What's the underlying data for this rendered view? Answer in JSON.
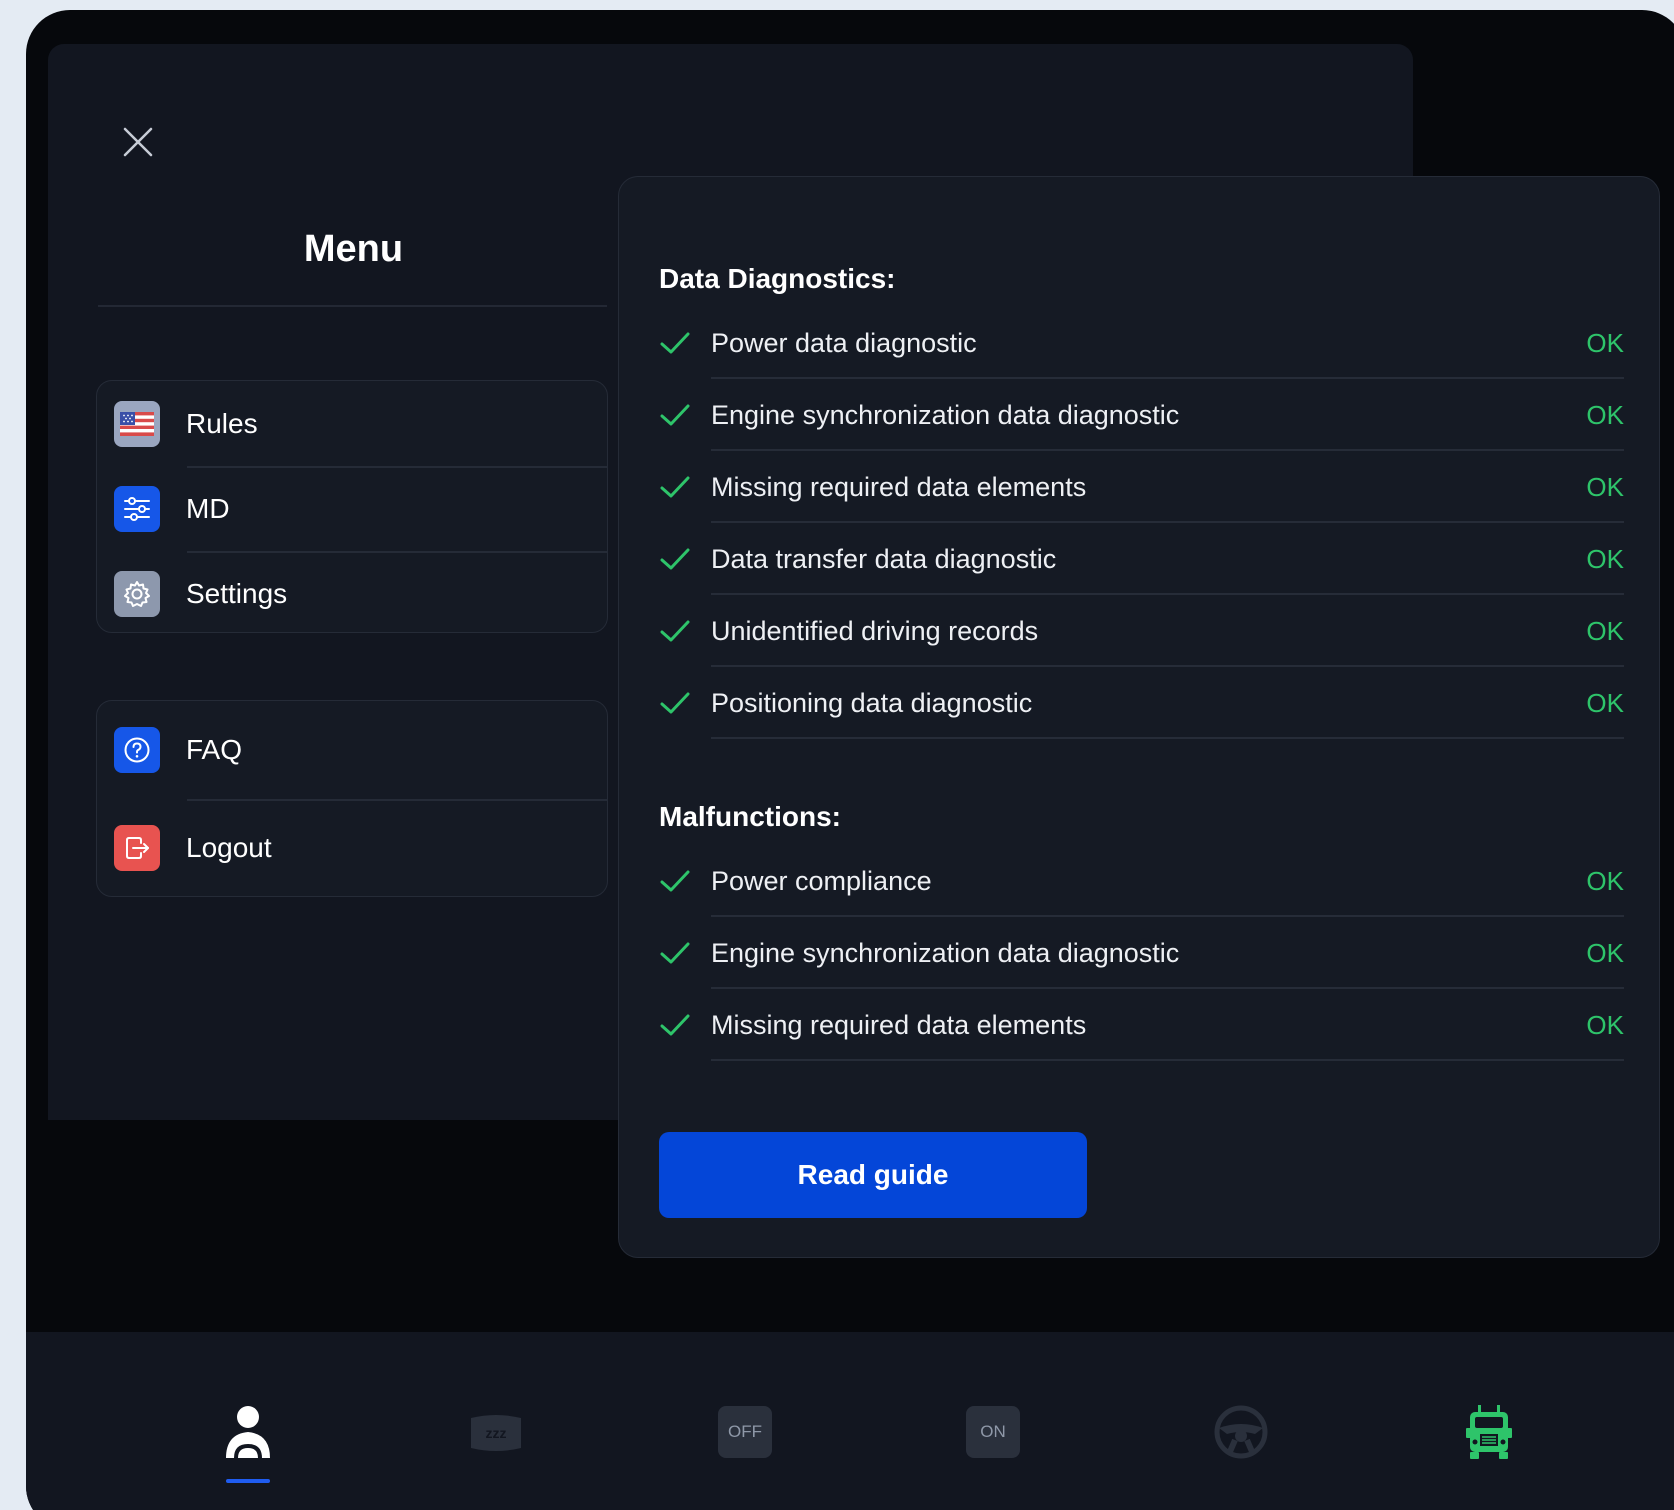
{
  "menu": {
    "title": "Menu",
    "top_items": [
      {
        "label": "Rules",
        "icon": "us-flag-icon"
      },
      {
        "label": "MD",
        "icon": "sliders-icon"
      },
      {
        "label": "Settings",
        "icon": "gear-icon"
      }
    ],
    "bottom_items": [
      {
        "label": "FAQ",
        "icon": "question-icon"
      },
      {
        "label": "Logout",
        "icon": "logout-icon"
      }
    ]
  },
  "diagnostics": {
    "data_title": "Data Diagnostics:",
    "data_items": [
      {
        "label": "Power data diagnostic",
        "status": "OK"
      },
      {
        "label": "Engine synchronization data diagnostic",
        "status": "OK"
      },
      {
        "label": "Missing required data elements",
        "status": "OK"
      },
      {
        "label": "Data transfer data diagnostic",
        "status": "OK"
      },
      {
        "label": "Unidentified driving records",
        "status": "OK"
      },
      {
        "label": "Positioning data diagnostic",
        "status": "OK"
      }
    ],
    "malfunctions_title": "Malfunctions:",
    "malfunction_items": [
      {
        "label": "Power compliance",
        "status": "OK"
      },
      {
        "label": "Engine synchronization data diagnostic",
        "status": "OK"
      },
      {
        "label": "Missing required data elements",
        "status": "OK"
      }
    ],
    "read_guide_label": "Read guide"
  },
  "bottom_nav": {
    "items": [
      {
        "icon": "driver-icon",
        "label": "",
        "active": true
      },
      {
        "icon": "sleeper-icon",
        "label": ""
      },
      {
        "icon": "off-duty-icon",
        "label": "OFF"
      },
      {
        "icon": "on-duty-icon",
        "label": "ON"
      },
      {
        "icon": "steering-wheel-icon",
        "label": ""
      },
      {
        "icon": "truck-icon",
        "label": ""
      }
    ]
  },
  "colors": {
    "accent": "#0446d8",
    "ok": "#2ec46a",
    "danger": "#e85350",
    "truck": "#2ec46a"
  }
}
